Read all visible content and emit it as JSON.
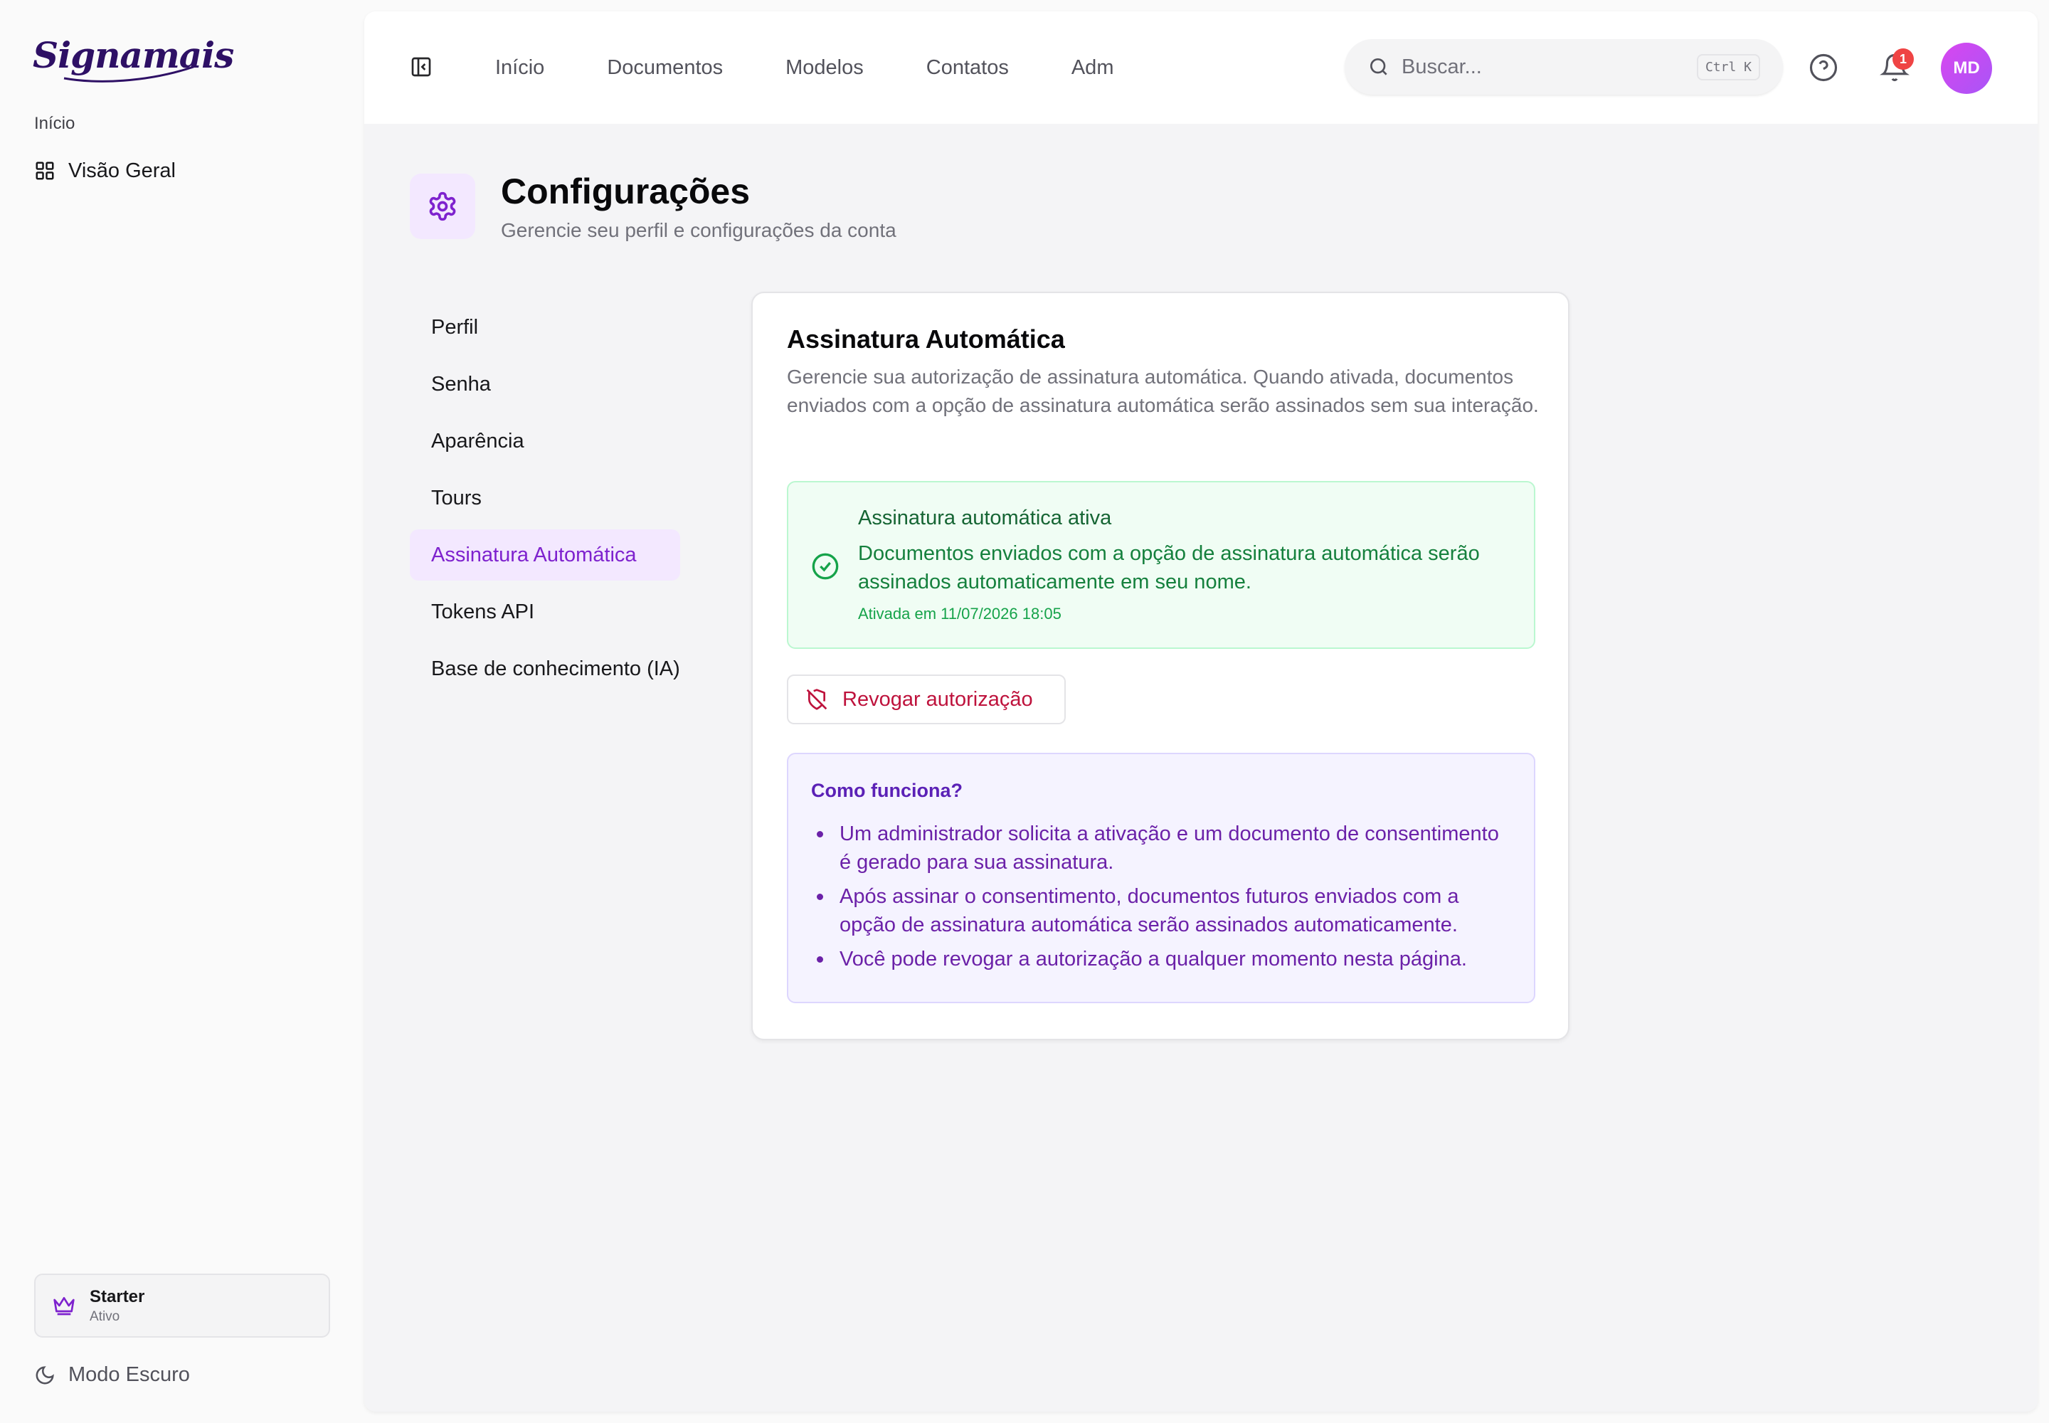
{
  "brand": {
    "name": "Signamais"
  },
  "sidebar": {
    "group_label": "Início",
    "items": [
      {
        "label": "Visão Geral",
        "icon": "grid-icon"
      }
    ],
    "plan": {
      "name": "Starter",
      "status": "Ativo",
      "icon": "crown-icon"
    },
    "dark_mode_label": "Modo Escuro"
  },
  "topbar": {
    "nav": [
      "Início",
      "Documentos",
      "Modelos",
      "Contatos",
      "Adm"
    ],
    "search": {
      "placeholder": "Buscar...",
      "shortcut": "Ctrl K"
    },
    "notifications_count": "1",
    "avatar_initials": "MD"
  },
  "page": {
    "title": "Configurações",
    "subtitle": "Gerencie seu perfil e configurações da conta"
  },
  "settings_nav": {
    "items": [
      "Perfil",
      "Senha",
      "Aparência",
      "Tours",
      "Assinatura Automática",
      "Tokens API",
      "Base de conhecimento (IA)"
    ],
    "active_index": 4
  },
  "card": {
    "title": "Assinatura Automática",
    "description": "Gerencie sua autorização de assinatura automática. Quando ativada, documentos enviados com a opção de assinatura automática serão assinados sem sua interação.",
    "status": {
      "title": "Assinatura automática ativa",
      "text": "Documentos enviados com a opção de assinatura automática serão assinados automaticamente em seu nome.",
      "date": "Ativada em 11/07/2026 18:05"
    },
    "revoke_label": "Revogar autorização",
    "info": {
      "title": "Como funciona?",
      "items": [
        "Um administrador solicita a ativação e um documento de consentimento é gerado para sua assinatura.",
        "Após assinar o consentimento, documentos futuros enviados com a opção de assinatura automática serão assinados automaticamente.",
        "Você pode revogar a autorização a qualquer momento nesta página."
      ]
    }
  },
  "colors": {
    "accent": "#7e22ce",
    "success": "#15803d",
    "danger": "#be123c",
    "badge": "#ef4444"
  }
}
